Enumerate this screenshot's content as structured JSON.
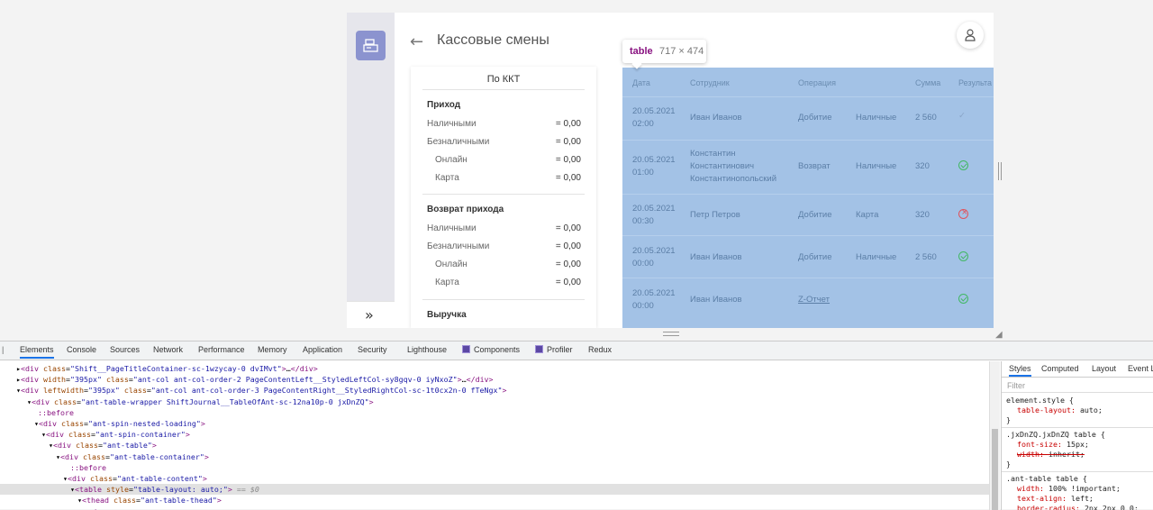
{
  "app": {
    "page_title": "Кассовые смены",
    "expand_glyph": "»",
    "kkt_panel": {
      "title": "По ККТ",
      "sections": [
        {
          "title": "Приход",
          "rows": [
            {
              "label": "Наличными",
              "value": "= 0,00"
            },
            {
              "label": "Безналичными",
              "value": "= 0,00"
            },
            {
              "label": "Онлайн",
              "value": "= 0,00"
            },
            {
              "label": "Карта",
              "value": "= 0,00"
            }
          ]
        },
        {
          "title": "Возврат прихода",
          "rows": [
            {
              "label": "Наличными",
              "value": "= 0,00"
            },
            {
              "label": "Безналичными",
              "value": "= 0,00"
            },
            {
              "label": "Онлайн",
              "value": "= 0,00"
            },
            {
              "label": "Карта",
              "value": "= 0,00"
            }
          ]
        },
        {
          "title": "Выручка",
          "rows": []
        }
      ]
    },
    "table": {
      "headers": [
        "Дата",
        "Сотрудник",
        "Операция",
        "Сумма",
        "Результа"
      ],
      "rows": [
        {
          "date": "20.05.2021",
          "time": "02:00",
          "employee": [
            "Иван Иванов"
          ],
          "operation": "Добитие",
          "payment": "Наличные",
          "amount": "2 560",
          "status": "pending"
        },
        {
          "date": "20.05.2021",
          "time": "01:00",
          "employee": [
            "Константин",
            "Константинович",
            "Константинопольский"
          ],
          "operation": "Возврат",
          "payment": "Наличные",
          "amount": "320",
          "status": "ok"
        },
        {
          "date": "20.05.2021",
          "time": "00:30",
          "employee": [
            "Петр Петров"
          ],
          "operation": "Добитие",
          "payment": "Карта",
          "amount": "320",
          "status": "error"
        },
        {
          "date": "20.05.2021",
          "time": "00:00",
          "employee": [
            "Иван Иванов"
          ],
          "operation": "Добитие",
          "payment": "Наличные",
          "amount": "2 560",
          "status": "ok"
        },
        {
          "date": "20.05.2021",
          "time": "00:00",
          "employee": [
            "Иван Иванов"
          ],
          "operation": "Z-Отчет",
          "payment": "",
          "amount": "",
          "status": "ok"
        }
      ],
      "colors": {
        "highlight": "#a3c2e6",
        "ok": "#42b865",
        "error": "#e0535c"
      }
    },
    "tooltip": {
      "tag": "table",
      "size": "717 × 474"
    }
  },
  "devtools": {
    "tabs": [
      "Elements",
      "Console",
      "Sources",
      "Network",
      "Performance",
      "Memory",
      "Application",
      "Security",
      "Lighthouse",
      "Components",
      "Profiler",
      "Redux"
    ],
    "active_tab": "Elements",
    "dom_lines": [
      {
        "html": "▸<span class='tag'>&lt;div</span> <span class='attr'>class</span>=<span class='val'>\"Shift__PageTitleContainer-sc-1wzycay-0 dvIMvt\"</span><span class='tag'>&gt;</span>…<span class='tag'>&lt;/div&gt;</span>"
      },
      {
        "html": "▸<span class='tag'>&lt;div</span> <span class='attr'>width</span>=<span class='val'>\"395px\"</span> <span class='attr'>class</span>=<span class='val'>\"ant-col ant-col-order-2 PageContentLeft__StyledLeftCol-sy8gqv-0 iyNxoZ\"</span><span class='tag'>&gt;</span>…<span class='tag'>&lt;/div&gt;</span>"
      },
      {
        "html": "▾<span class='tag'>&lt;div</span> <span class='attr'>leftwidth</span>=<span class='val'>\"395px\"</span> <span class='attr'>class</span>=<span class='val'>\"ant-col ant-col-order-3 PageContentRight__StyledRightCol-sc-1t0cx2n-0 fTeNgx\"</span><span class='tag'>&gt;</span>"
      },
      {
        "html": "▾<span class='tag'>&lt;div</span> <span class='attr'>class</span>=<span class='val'>\"ant-table-wrapper ShiftJournal__TableOfAnt-sc-12na10p-0 jxDnZQ\"</span><span class='tag'>&gt;</span>"
      },
      {
        "html": "<span class='pseudo'>::before</span>"
      },
      {
        "html": "▾<span class='tag'>&lt;div</span> <span class='attr'>class</span>=<span class='val'>\"ant-spin-nested-loading\"</span><span class='tag'>&gt;</span>"
      },
      {
        "html": "▾<span class='tag'>&lt;div</span> <span class='attr'>class</span>=<span class='val'>\"ant-spin-container\"</span><span class='tag'>&gt;</span>"
      },
      {
        "html": "▾<span class='tag'>&lt;div</span> <span class='attr'>class</span>=<span class='val'>\"ant-table\"</span><span class='tag'>&gt;</span>"
      },
      {
        "html": "▾<span class='tag'>&lt;div</span> <span class='attr'>class</span>=<span class='val'>\"ant-table-container\"</span><span class='tag'>&gt;</span>"
      },
      {
        "html": "<span class='pseudo'>::before</span>"
      },
      {
        "html": "▾<span class='tag'>&lt;div</span> <span class='attr'>class</span>=<span class='val'>\"ant-table-content\"</span><span class='tag'>&gt;</span>"
      },
      {
        "html": "▾<span class='tag'>&lt;table</span> <span class='attr'>style</span>=<span class='val'>\"table-layout: auto;\"</span><span class='tag'>&gt;</span> <span class='dollar'>== $0</span>"
      },
      {
        "html": "▾<span class='tag'>&lt;thead</span> <span class='attr'>class</span>=<span class='val'>\"ant-table-thead\"</span><span class='tag'>&gt;</span>"
      },
      {
        "html": "▾<span class='tag'>&lt;tr&gt;</span>"
      }
    ],
    "selected_line": 11,
    "styles_tabs": [
      "Styles",
      "Computed",
      "Layout",
      "Event L"
    ],
    "filter_placeholder": "Filter",
    "css_rules": [
      {
        "selector": "element.style {",
        "decls": [
          {
            "prop": "table-layout",
            "val": "auto;",
            "strike": false
          }
        ]
      },
      {
        "selector": ".jxDnZQ.jxDnZQ table {",
        "decls": [
          {
            "prop": "font-size",
            "val": "15px;",
            "strike": false
          },
          {
            "prop": "width",
            "val": "inherit;",
            "strike": true
          }
        ]
      },
      {
        "selector": ".ant-table table {",
        "decls": [
          {
            "prop": "width",
            "val": "100% !important;",
            "strike": false
          },
          {
            "prop": "text-align",
            "val": "left;",
            "strike": false
          },
          {
            "prop": "border-radius",
            "val": "2px 2px 0 0;",
            "strike": false
          }
        ]
      }
    ]
  }
}
